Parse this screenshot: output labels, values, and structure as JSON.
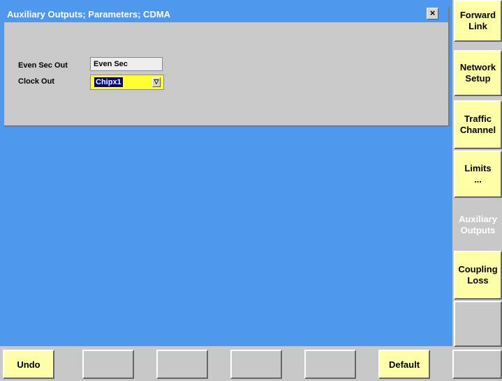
{
  "dialog": {
    "title": "Auxiliary Outputs; Parameters; CDMA",
    "close_glyph": "×",
    "even_sec_out": {
      "label": "Even Sec Out",
      "value": "Even Sec"
    },
    "clock_out": {
      "label": "Clock Out",
      "value": "Chipx1",
      "arrow_glyph": "▽"
    }
  },
  "right_softkeys": [
    {
      "label": "Forward\nLink",
      "state": "normal"
    },
    {
      "label": "Network\nSetup",
      "state": "normal"
    },
    {
      "label": "Traffic\nChannel",
      "state": "normal"
    },
    {
      "label": "Limits\n...",
      "state": "normal"
    },
    {
      "label": "Auxiliary\nOutputs",
      "state": "active"
    },
    {
      "label": "Coupling\nLoss",
      "state": "normal"
    },
    {
      "label": "",
      "state": "empty"
    }
  ],
  "bottom_softkeys": [
    {
      "label": "Undo"
    },
    {
      "label": ""
    },
    {
      "label": ""
    },
    {
      "label": ""
    },
    {
      "label": ""
    },
    {
      "label": "Default"
    },
    {
      "label": ""
    }
  ],
  "colors": {
    "main_background": "#4f98f0",
    "softkey_yellow": "#ffffa8",
    "field_highlight": "#ffff33",
    "selection": "#000088"
  }
}
